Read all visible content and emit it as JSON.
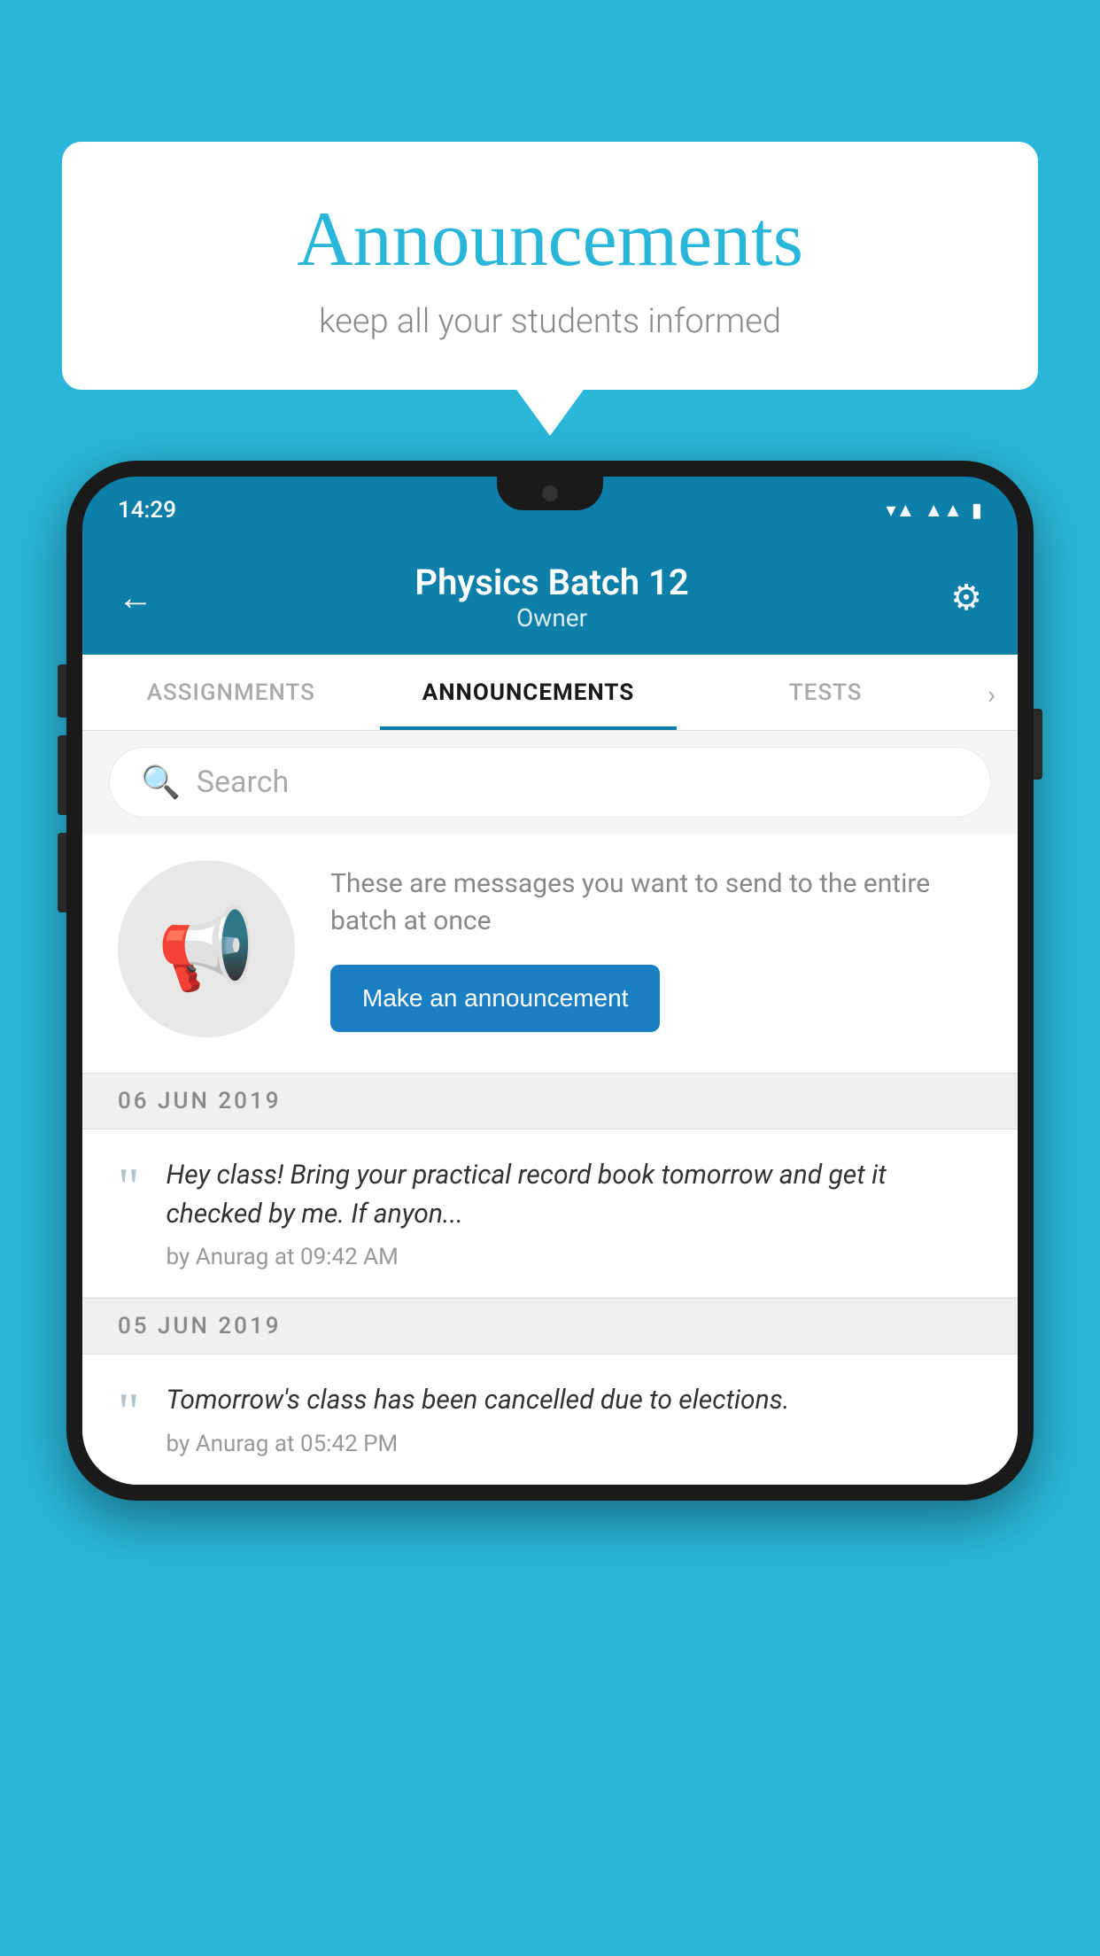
{
  "background_color": "#29b6d8",
  "speech_bubble": {
    "title": "Announcements",
    "subtitle": "keep all your students informed"
  },
  "phone": {
    "status_bar": {
      "time": "14:29"
    },
    "header": {
      "title": "Physics Batch 12",
      "subtitle": "Owner",
      "back_label": "←",
      "gear_label": "⚙"
    },
    "tabs": [
      {
        "label": "ASSIGNMENTS",
        "active": false
      },
      {
        "label": "ANNOUNCEMENTS",
        "active": true
      },
      {
        "label": "TESTS",
        "active": false
      }
    ],
    "search": {
      "placeholder": "Search"
    },
    "empty_state": {
      "description": "These are messages you want to send to the entire batch at once",
      "button_label": "Make an announcement"
    },
    "announcements": [
      {
        "date": "06  JUN  2019",
        "message": "Hey class! Bring your practical record book tomorrow and get it checked by me. If anyon...",
        "meta": "by Anurag at 09:42 AM"
      },
      {
        "date": "05  JUN  2019",
        "message": "Tomorrow's class has been cancelled due to elections.",
        "meta": "by Anurag at 05:42 PM"
      }
    ]
  }
}
